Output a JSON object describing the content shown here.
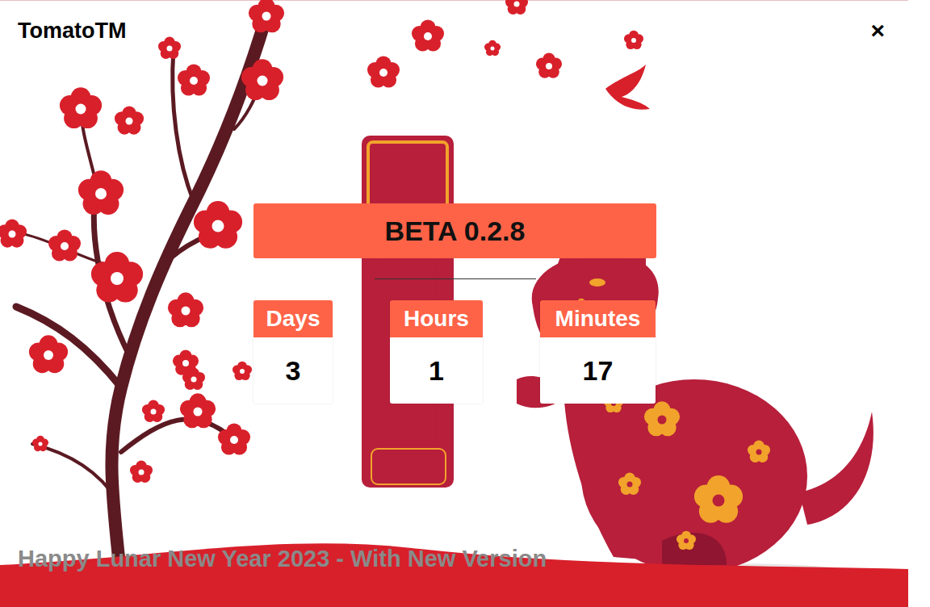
{
  "window": {
    "title": "TomatoTM",
    "close": "×"
  },
  "version": "BETA 0.2.8",
  "countdown": [
    {
      "label": "Days",
      "value": "3"
    },
    {
      "label": "Hours",
      "value": "1"
    },
    {
      "label": "Minutes",
      "value": "17"
    }
  ],
  "footer": "Happy Lunar New Year 2023 - With New Version"
}
